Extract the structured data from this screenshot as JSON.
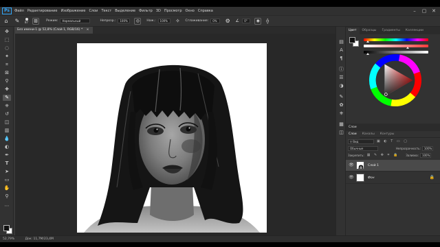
{
  "app": {
    "logo": "Ps"
  },
  "menu": [
    "Файл",
    "Редактирование",
    "Изображение",
    "Слои",
    "Текст",
    "Выделение",
    "Фильтр",
    "3D",
    "Просмотр",
    "Окно",
    "Справка"
  ],
  "window_controls": {
    "minimize": "–",
    "restore": "▢",
    "close": "✕"
  },
  "options": {
    "brush_size": "87",
    "mode_label": "Режим:",
    "mode_value": "Нормальный",
    "opacity_label": "Непрозр.:",
    "opacity_value": "100%",
    "flow_label": "Наж.:",
    "flow_value": "100%",
    "smoothing_label": "Сглаживание:",
    "smoothing_value": "0%",
    "angle_value": "0°"
  },
  "document": {
    "tab_title": "Без имени-1 @ 52,8% (Слой 1, RGB/16) *",
    "close": "×"
  },
  "status": {
    "zoom": "52,79%",
    "doc_info": "Док: 11,7M/23,4M"
  },
  "panels": {
    "color_tabs": [
      "Цвет",
      "Образцы",
      "Градиенты",
      "Коллекции"
    ],
    "colors": {
      "foreground": "#111111",
      "background": "#ffffff",
      "accent": "#31a8ff",
      "panel": "#323232",
      "canvas": "#282828"
    },
    "layers_header": "Слои",
    "layers_tabs": [
      "Слои",
      "Каналы",
      "Контуры"
    ],
    "search_label": "Вид",
    "blend_mode": "Обычные",
    "opacity_label": "Непрозрачность:",
    "opacity_value": "100%",
    "lock_label": "Закрепить:",
    "fill_label": "Заливка:",
    "fill_value": "100%",
    "layers": [
      {
        "name": "Слой 1",
        "selected": true
      },
      {
        "name": "Фон",
        "selected": false,
        "locked": true
      }
    ]
  }
}
